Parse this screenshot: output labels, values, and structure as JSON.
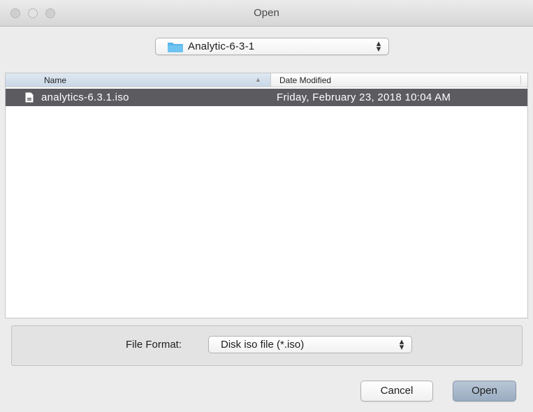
{
  "window": {
    "title": "Open"
  },
  "location": {
    "selected": "Analytic-6-3-1",
    "arrows": "⬆⬇"
  },
  "columns": {
    "name": "Name",
    "date_modified": "Date Modified"
  },
  "files": [
    {
      "name": "analytics-6.3.1.iso",
      "date_modified": "Friday, February 23, 2018 10:04 AM",
      "selected": true
    }
  ],
  "file_format": {
    "label": "File Format:",
    "selected": "Disk iso file (*.iso)"
  },
  "buttons": {
    "cancel": "Cancel",
    "open": "Open"
  },
  "colors": {
    "selection": "#5b5b60",
    "folder": "#5bb5ea",
    "default_button": "#a9b8ca"
  }
}
